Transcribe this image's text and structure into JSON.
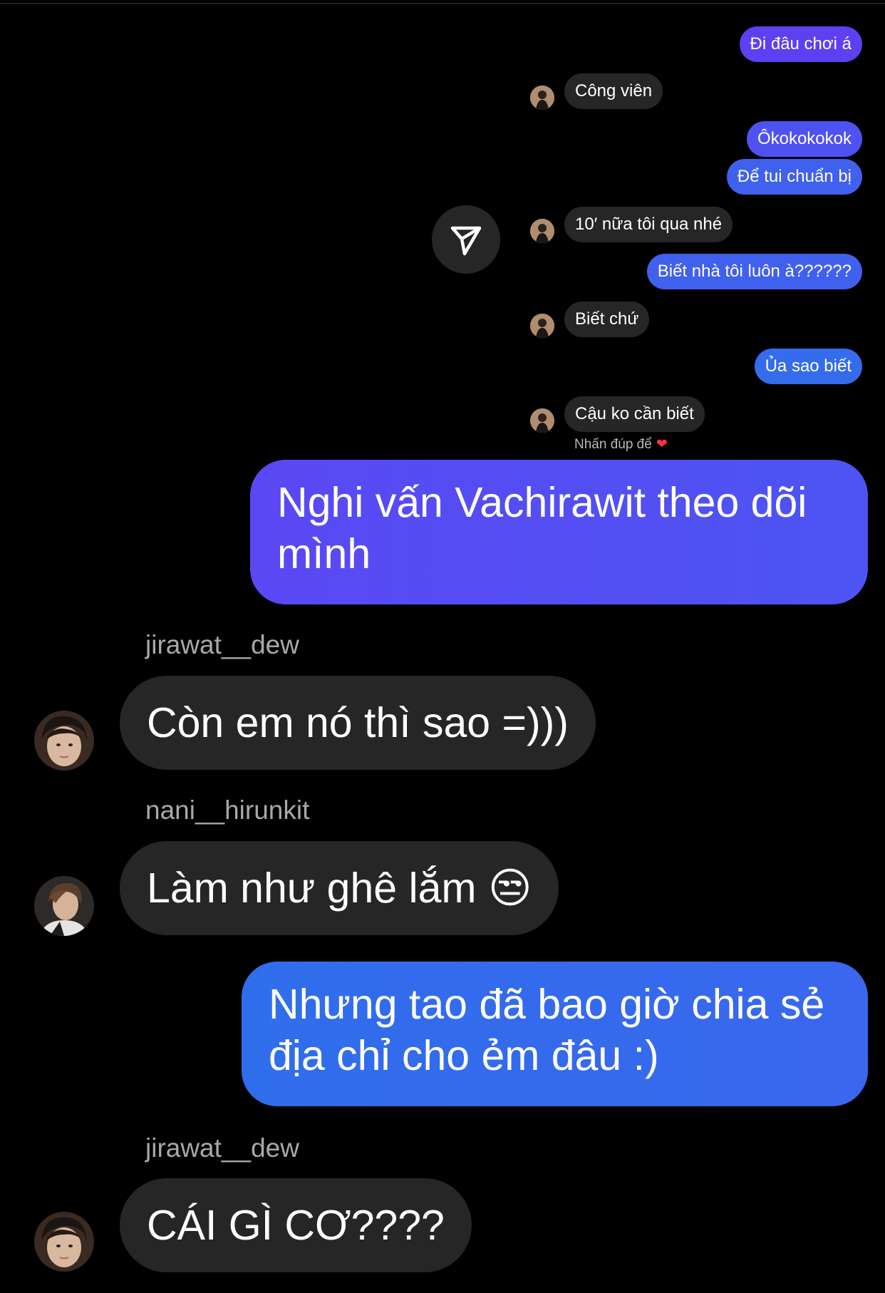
{
  "story_chat": {
    "messages": [
      {
        "side": "out",
        "text": "Đi đâu chơi á"
      },
      {
        "side": "in",
        "text": "Công viên"
      },
      {
        "side": "out",
        "text": "Ôkokokokok"
      },
      {
        "side": "out",
        "text": "Để tui chuẩn bị"
      },
      {
        "side": "in",
        "text": "10′ nữa tôi qua nhé"
      },
      {
        "side": "out",
        "text": "Biết nhà tôi luôn à??????"
      },
      {
        "side": "in",
        "text": "Biết chứ"
      },
      {
        "side": "out",
        "text": "Ủa sao biết"
      },
      {
        "side": "in",
        "text": "Cậu ko cần biết"
      }
    ],
    "double_tap_hint": "Nhấn đúp để",
    "heart_icon": "red-heart-icon"
  },
  "share_button": {
    "icon": "send-paper-plane-icon"
  },
  "chat": {
    "messages": [
      {
        "type": "outgoing",
        "text": "Nghi vấn Vachirawit theo dõi mình"
      },
      {
        "type": "incoming",
        "sender": "jirawat__dew",
        "text": "Còn em nó thì sao =)))"
      },
      {
        "type": "incoming",
        "sender": "nani__hirunkit",
        "text": "Làm như ghê lắm 😒"
      },
      {
        "type": "outgoing",
        "text": "Nhưng tao đã bao giờ chia sẻ địa chỉ cho ẻm đâu :)"
      },
      {
        "type": "incoming",
        "sender": "jirawat__dew",
        "text": "CÁI GÌ CƠ????"
      }
    ]
  },
  "colors": {
    "background": "#000000",
    "incoming_bubble": "#262626",
    "outgoing_bubble_purple": "#5a48f4",
    "outgoing_bubble_blue": "#2f6eeb"
  }
}
